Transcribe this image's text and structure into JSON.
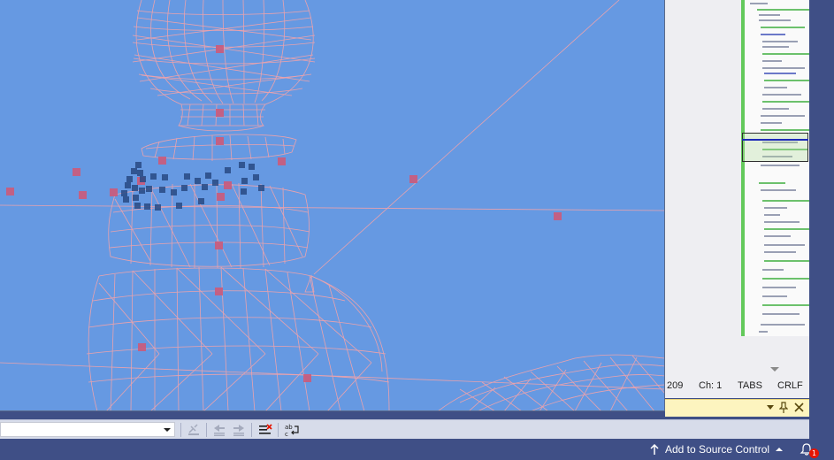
{
  "editor": {
    "line_number": "209",
    "column": "Ch: 1",
    "indent_mode": "TABS",
    "line_ending": "CRLF"
  },
  "tool_window": {
    "dropdown_label": "▾",
    "pin_label": "📌",
    "close_label": "✕"
  },
  "toolbar": {
    "combo_value": ""
  },
  "statusbar": {
    "source_control_label": "Add to Source Control",
    "notification_count": "1"
  },
  "viewport": {
    "background_color": "#6699e2",
    "wireframe_color": "#f0a0a8",
    "vertex_color": "#cc5a7a",
    "point_color": "#284a84"
  }
}
